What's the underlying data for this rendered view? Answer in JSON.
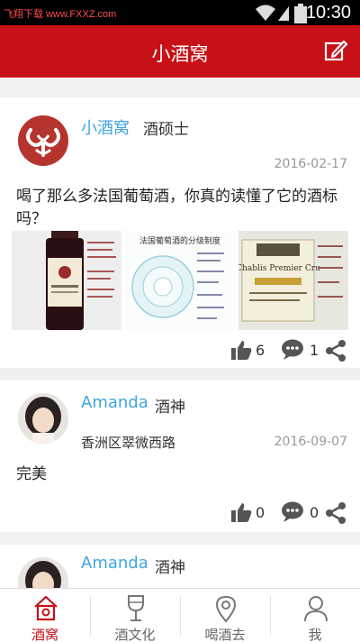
{
  "status": {
    "watermark": "飞翔下载 www.FXXZ.com",
    "time": "10:30"
  },
  "header": {
    "title": "小酒窝",
    "edit_icon": "edit-icon"
  },
  "posts": [
    {
      "author": "小酒窝",
      "author_title": "酒硕士",
      "date": "2016-02-17",
      "text_line1": "喝了那么多法国葡萄酒，你真的读懂了它的酒标",
      "text_line2": "吗？",
      "image2_caption": "法国葡萄酒的分级制度",
      "image3_caption": "Chablis Premier Cru",
      "likes": "6",
      "comments": "1"
    },
    {
      "author": "Amanda",
      "author_title": "酒神",
      "location": "香洲区翠微西路",
      "date": "2016-09-07",
      "text": "完美",
      "likes": "0",
      "comments": "0"
    },
    {
      "author": "Amanda",
      "author_title": "酒神"
    }
  ],
  "tabs": [
    {
      "label": "酒窝",
      "icon": "home-icon",
      "active": true
    },
    {
      "label": "酒文化",
      "icon": "wine-glass-icon",
      "active": false
    },
    {
      "label": "喝酒去",
      "icon": "location-pin-icon",
      "active": false
    },
    {
      "label": "我",
      "icon": "person-icon",
      "active": false
    }
  ],
  "colors": {
    "brand": "#c81018",
    "link": "#3fa6e0",
    "background": "#f1f1f1"
  }
}
